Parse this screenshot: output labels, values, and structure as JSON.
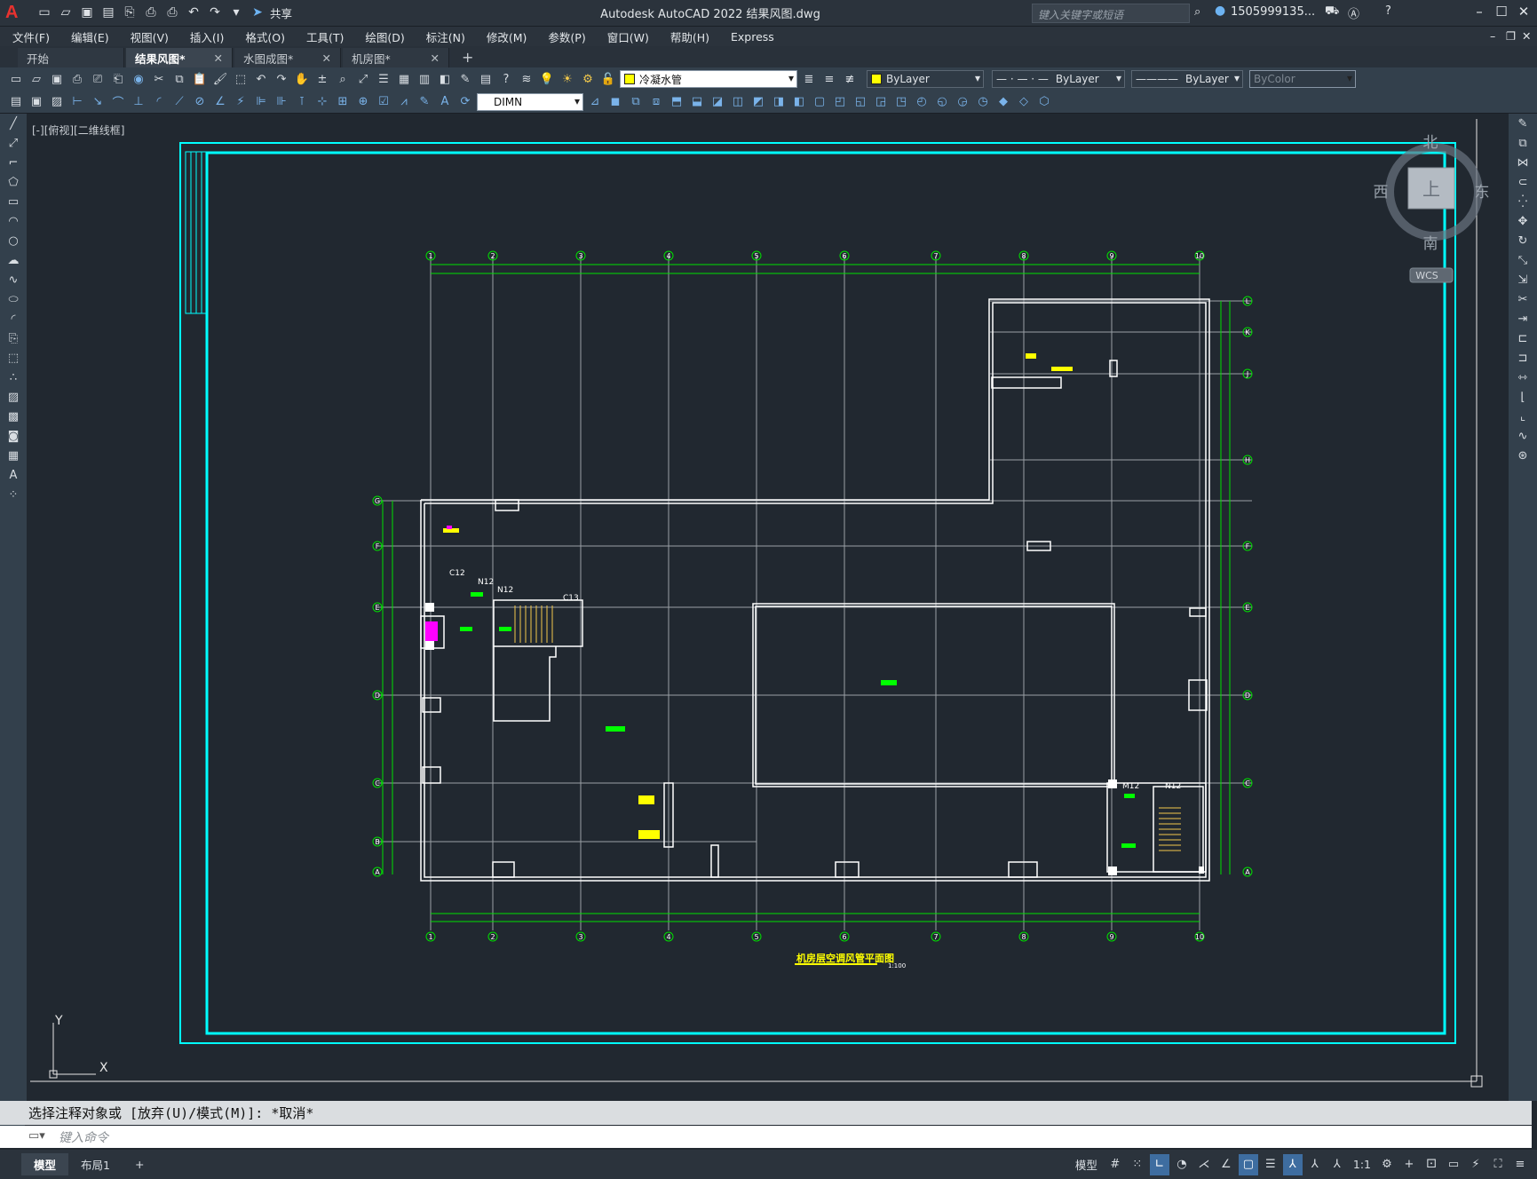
{
  "app": {
    "logo": "A",
    "title": "Autodesk AutoCAD 2022    结果风图.dwg",
    "share": "共享",
    "search_placeholder": "键入关键字或短语",
    "user": "1505999135..."
  },
  "menu": [
    "文件(F)",
    "编辑(E)",
    "视图(V)",
    "插入(I)",
    "格式(O)",
    "工具(T)",
    "绘图(D)",
    "标注(N)",
    "修改(M)",
    "参数(P)",
    "窗口(W)",
    "帮助(H)",
    "Express"
  ],
  "tabs": [
    {
      "label": "开始",
      "close": ""
    },
    {
      "label": "结果风图*",
      "close": "✕"
    },
    {
      "label": "水图成图*",
      "close": "✕"
    },
    {
      "label": "机房图*",
      "close": "✕"
    }
  ],
  "toolbar": {
    "layer": "冷凝水管",
    "color": "ByLayer",
    "linetype": "ByLayer",
    "lineweight": "ByLayer",
    "plotstyle": "ByColor",
    "dimstyle": "DIMN"
  },
  "viewport": {
    "label": "[-][俯视][二维线框]",
    "compass": {
      "n": "北",
      "s": "南",
      "e": "东",
      "w": "西",
      "top": "上"
    },
    "ucs": "WCS",
    "axis_y": "Y",
    "axis_x": "X"
  },
  "drawing": {
    "grid_top": [
      "1",
      "2",
      "3",
      "4",
      "5",
      "6",
      "7",
      "8",
      "9",
      "10"
    ],
    "grid_right": [
      "L",
      "K",
      "J",
      "H",
      "F",
      "E",
      "D",
      "C",
      "A"
    ],
    "grid_left": [
      "G",
      "F",
      "E",
      "D",
      "C",
      "B",
      "A"
    ],
    "labels": {
      "c12": "C12",
      "n12a": "N12",
      "c13": "C13",
      "n12b": "N12",
      "n12c": "N12",
      "m12": "M12"
    },
    "title": "机房层空调风管平面图",
    "scale": "1:100"
  },
  "command": {
    "history": "选择注释对象或 [放弃(U)/模式(M)]: *取消*",
    "placeholder": "键入命令"
  },
  "status": {
    "model_tab": "模型",
    "layout_tab": "布局1",
    "model_btn": "模型",
    "scale": "1:1"
  }
}
